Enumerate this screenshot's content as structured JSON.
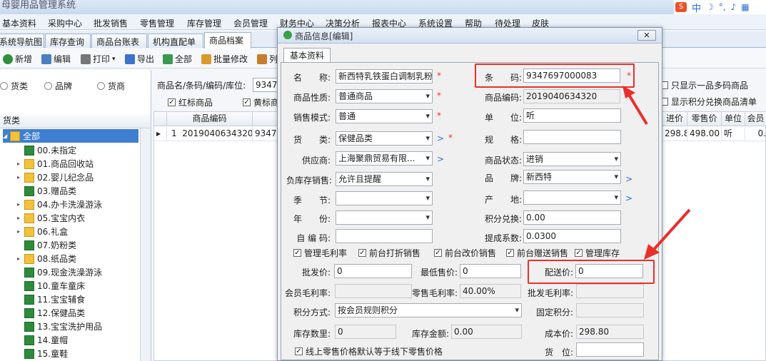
{
  "app": {
    "title": "母婴用品管理系统"
  },
  "menu": [
    "基本资料",
    "采购中心",
    "批发销售",
    "零售管理",
    "库存管理",
    "会员管理",
    "财务中心",
    "决策分析",
    "报表中心",
    "系统设置",
    "帮助",
    "待处理",
    "皮肤"
  ],
  "tray": {
    "ime": "中"
  },
  "tabs": [
    "系统导航图",
    "库存查询",
    "商品台账表",
    "机构直配单",
    "商品档案"
  ],
  "toolbar": {
    "new": "新增",
    "edit": "编辑",
    "print": "打印",
    "export": "导出",
    "all": "全部",
    "batch": "批量修改",
    "col": "列"
  },
  "filter": {
    "radio_a": "货类",
    "radio_b": "品牌",
    "radio_c": "货商",
    "search_label": "商品名/条码/编码/库位:",
    "search_value": "9347",
    "red_label": "红标商品",
    "yellow_label": "黄标商",
    "only_one": "只显示一品多码商品",
    "points_list": "显示积分兑换商品清单"
  },
  "tree": {
    "header": "货类",
    "items": [
      "全部",
      "00.未指定",
      "01.商品回收站",
      "02.婴儿纪念品",
      "03.赠品类",
      "04.办卡洗澡游泳",
      "05.宝宝内衣",
      "06.礼盒",
      "07.奶粉类",
      "08.纸品类",
      "09.现金洗澡游泳",
      "10.童车童床",
      "11.宝宝辅食",
      "12.保健品类",
      "13.宝宝洗护用品",
      "14.童帽",
      "15.童鞋"
    ]
  },
  "grid": {
    "headers": {
      "code": "商品编码",
      "cost": "进价",
      "retail": "零售价",
      "unit": "单位",
      "member": "会员"
    },
    "row": {
      "idx": "1",
      "code": "2019040634320",
      "barcode": "9347",
      "cost": "298.80",
      "retail": "498.00",
      "unit": "听",
      "member": "0."
    }
  },
  "dialog": {
    "title": "商品信息[编辑]",
    "tab": "基本资料",
    "name_label": "名　　称:",
    "name_value": "新西特乳铁蛋白调制乳粉",
    "barcode_label": "条　　码:",
    "barcode_value": "9347697000083",
    "nature_label": "商品性质:",
    "nature_value": "普通商品",
    "code_label": "商品编码:",
    "code_value": "2019040634320",
    "mode_label": "销售模式:",
    "mode_value": "普通",
    "unit_label": "单　　位:",
    "unit_value": "听",
    "category_label": "货　　类:",
    "category_value": "保健品类",
    "spec_label": "规　　格:",
    "spec_value": "",
    "supplier_label": "供应商:",
    "supplier_value": "上海聚鼎贸易有限...",
    "status_label": "商品状态:",
    "status_value": "进销",
    "negstock_label": "负库存销售:",
    "negstock_value": "允许且提醒",
    "brand_label": "品　　牌:",
    "brand_value": "新西特",
    "season_label": "季　　节:",
    "season_value": "",
    "origin_label": "产　　地:",
    "origin_value": "",
    "year_label": "年　　份:",
    "year_value": "",
    "points_label": "积分兑换:",
    "points_value": "0.00",
    "selfcode_label": "自 编 码:",
    "selfcode_value": "",
    "commission_label": "提成系数:",
    "commission_value": "0.0300",
    "checks": [
      "管理毛利率",
      "前台打折销售",
      "前台改价销售",
      "前台赠送销售",
      "管理库存"
    ],
    "wholesale_label": "批发价:",
    "wholesale_value": "0",
    "minprice_label": "最低售价:",
    "minprice_value": "0",
    "delivery_label": "配送价:",
    "delivery_value": "0",
    "member_margin_label": "会员毛利率:",
    "member_margin_value": "",
    "retail_margin_label": "零售毛利率:",
    "retail_margin_value": "40.00%",
    "wholesale_margin_label": "批发毛利率:",
    "wholesale_margin_value": "",
    "points_mode_label": "积分方式:",
    "points_mode_value": "按会员规则积分",
    "fixed_points_label": "固定积分:",
    "fixed_points_value": "",
    "stock_qty_label": "库存数里:",
    "stock_qty_value": "0",
    "stock_amt_label": "库存金额:",
    "stock_amt_value": "0.00",
    "cost_label": "成本价:",
    "cost_value": "298.80",
    "online_check": "线上零售价格默认等于线下零售价格",
    "location_label": "货　位:",
    "location_value": ""
  },
  "colors": {
    "accent_red": "#e8302b"
  }
}
